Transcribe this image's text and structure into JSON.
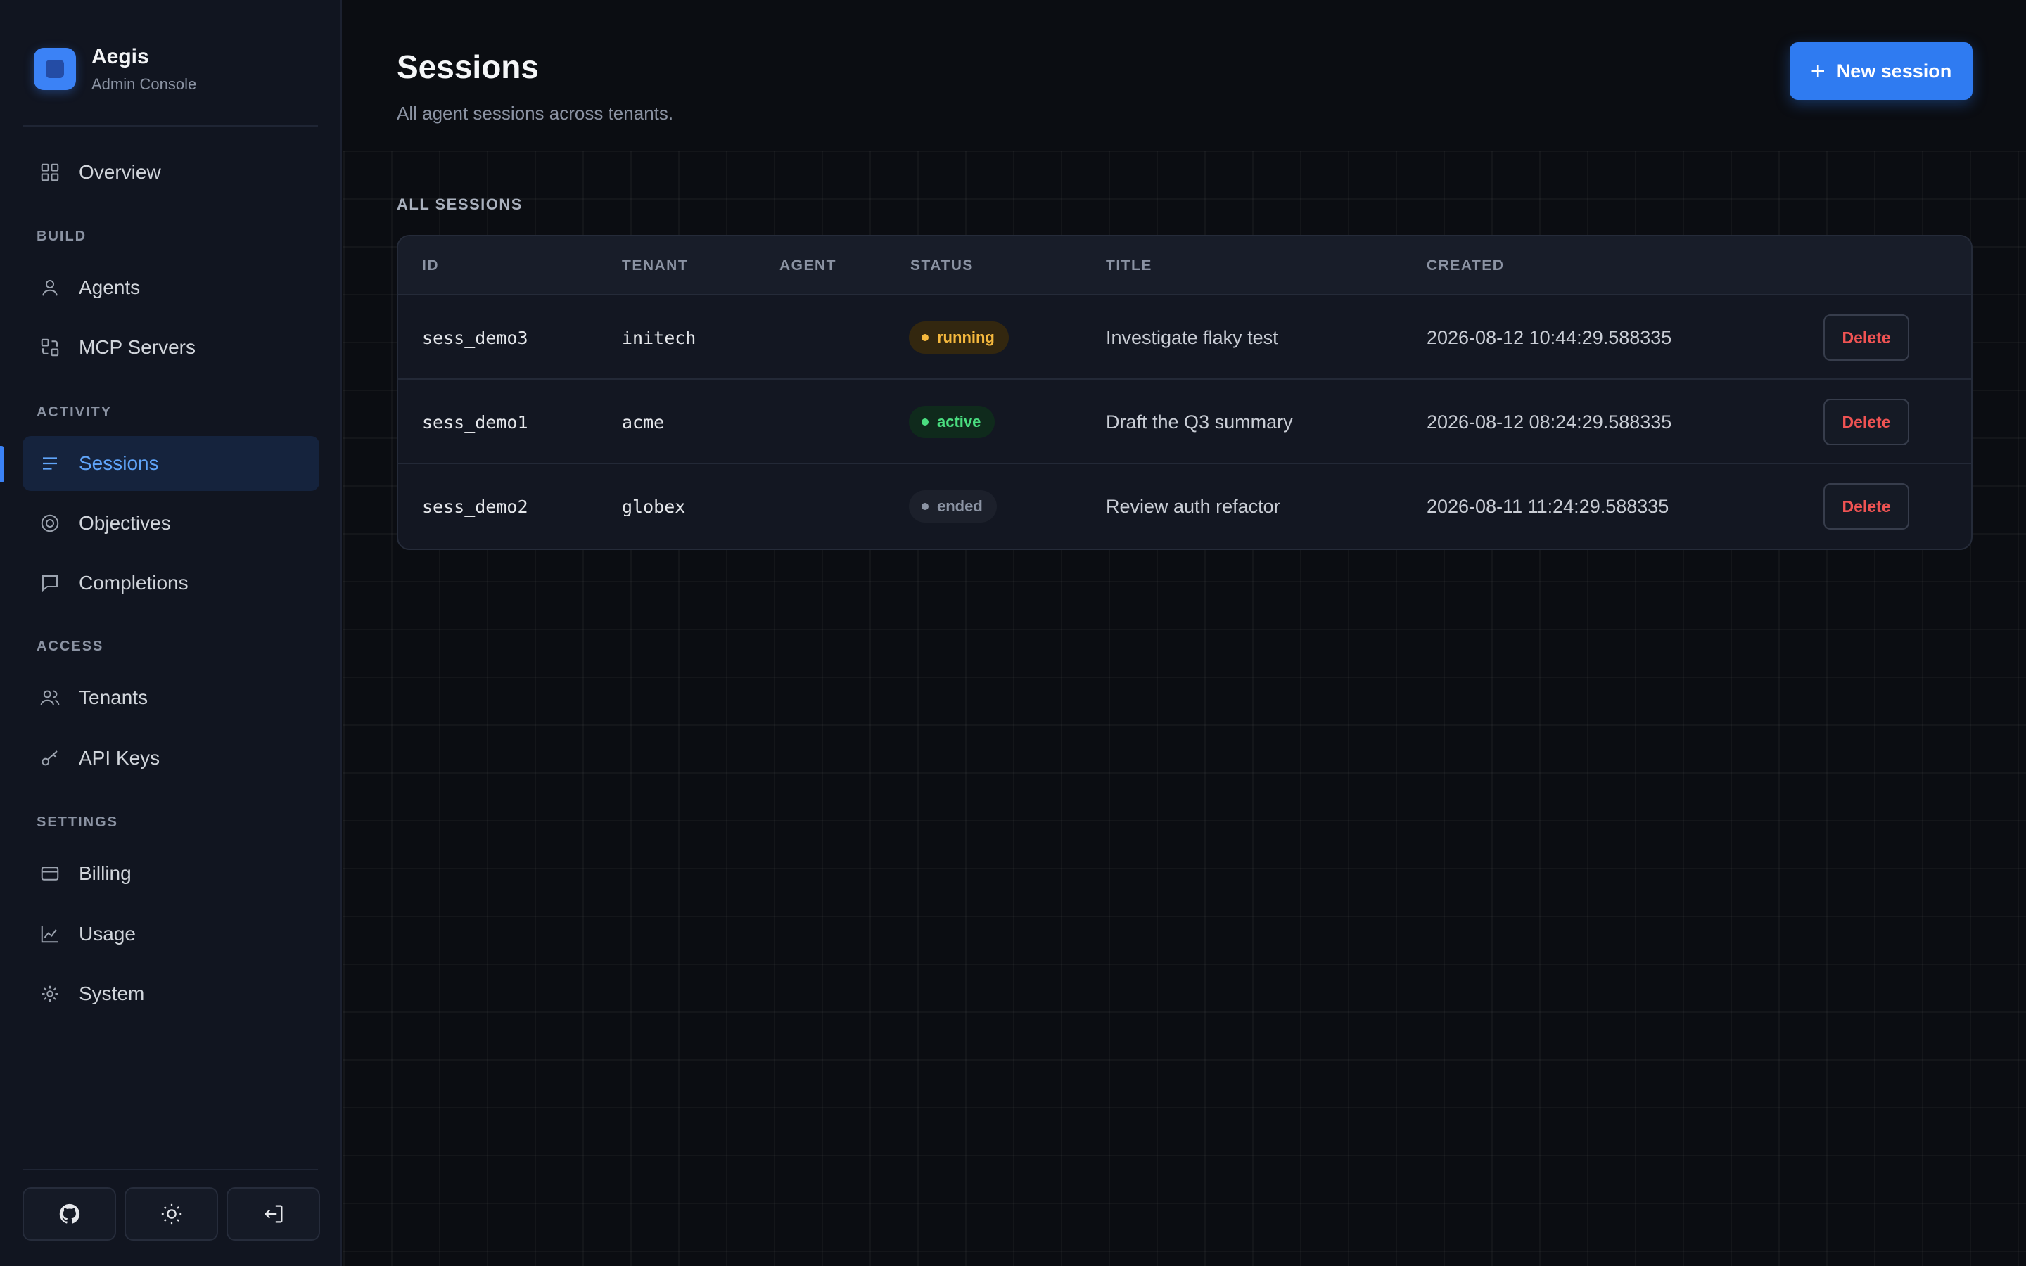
{
  "brand": {
    "name": "Aegis",
    "subtitle": "Admin Console"
  },
  "sidebar": {
    "overview": "Overview",
    "sections": {
      "build": "BUILD",
      "activity": "ACTIVITY",
      "access": "ACCESS",
      "settings": "SETTINGS"
    },
    "items": {
      "agents": "Agents",
      "mcp_servers": "MCP Servers",
      "sessions": "Sessions",
      "objectives": "Objectives",
      "completions": "Completions",
      "tenants": "Tenants",
      "api_keys": "API Keys",
      "billing": "Billing",
      "usage": "Usage",
      "system": "System"
    },
    "active_item": "sessions",
    "footer_icons": [
      "github-icon",
      "sun-icon",
      "logout-icon"
    ]
  },
  "header": {
    "title": "Sessions",
    "subtitle": "All agent sessions across tenants.",
    "new_button": "New session"
  },
  "table": {
    "section_label": "ALL SESSIONS",
    "columns": [
      "ID",
      "TENANT",
      "AGENT",
      "STATUS",
      "TITLE",
      "CREATED"
    ],
    "rows": [
      {
        "id": "sess_demo3",
        "tenant": "initech",
        "agent": "",
        "status": "running",
        "title": "Investigate flaky test",
        "created": "2026-08-12 10:44:29.588335",
        "action": "Delete"
      },
      {
        "id": "sess_demo1",
        "tenant": "acme",
        "agent": "",
        "status": "active",
        "title": "Draft the Q3 summary",
        "created": "2026-08-12 08:24:29.588335",
        "action": "Delete"
      },
      {
        "id": "sess_demo2",
        "tenant": "globex",
        "agent": "",
        "status": "ended",
        "title": "Review auth refactor",
        "created": "2026-08-11 11:24:29.588335",
        "action": "Delete"
      }
    ]
  },
  "colors": {
    "accent": "#2f7bf1",
    "running": "#f5b83d",
    "active": "#4ade80",
    "ended": "#8b93a3",
    "danger": "#ef5353"
  }
}
